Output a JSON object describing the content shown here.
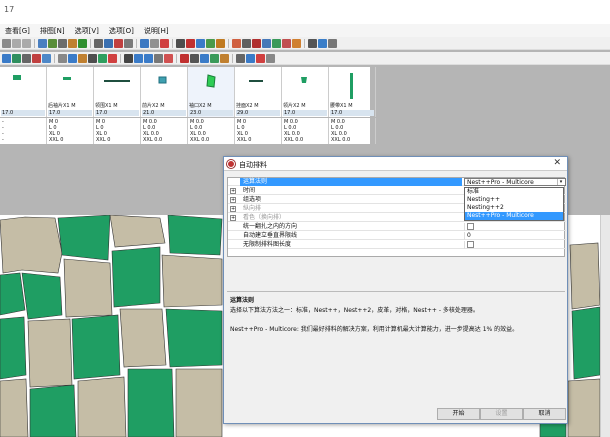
{
  "window": {
    "title": "17"
  },
  "menu": [
    "查看[G]",
    "排图[N]",
    "选项[V]",
    "选项[O]",
    "说明[H]"
  ],
  "colors": {
    "green": "#1f9e63",
    "tan": "#c5bda6",
    "selection": "#3399ff"
  },
  "pieces": [
    {
      "label": "",
      "size": "17.0"
    },
    {
      "label": "后袖片X1 M",
      "size": "17.0"
    },
    {
      "label": "领围X1 M",
      "size": "17.0"
    },
    {
      "label": "前片X2 M",
      "size": "21.0"
    },
    {
      "label": "袖口X2 M",
      "size": "23.0"
    },
    {
      "label": "挂面X2 M",
      "size": "29.0"
    },
    {
      "label": "领片X2 M",
      "size": "17.0"
    },
    {
      "label": "腰带X1 M",
      "size": "17.0"
    }
  ],
  "size_rows": [
    [
      "-",
      "-",
      "-",
      "-"
    ],
    [
      "M 0",
      "L 0",
      "XL 0",
      "XXL 0"
    ],
    [
      "M 0",
      "L 0",
      "XL 0",
      "XXL 0"
    ],
    [
      "M 0.0",
      "L 0.0",
      "XL 0.0",
      "XXL 0.0"
    ],
    [
      "M 0.0",
      "L 0.0",
      "XL 0.0",
      "XXL 0.0"
    ],
    [
      "M 0",
      "L 0",
      "XL 0",
      "XXL 0"
    ],
    [
      "M 0.0",
      "L 0.0",
      "XL 0.0",
      "XXL 0.0"
    ],
    [
      "M 0.0",
      "L 0.0",
      "XL 0.0",
      "XXL 0.0"
    ]
  ],
  "dialog": {
    "title": "自动排料",
    "close": "✕",
    "properties": {
      "algorithm": {
        "name": "运算法则",
        "value": "Nest++Pro - Multicore"
      },
      "time": {
        "name": "时间"
      },
      "group": {
        "name": "组选项"
      },
      "vertical": {
        "name": "纵向排"
      },
      "look": {
        "name": "看色（换向排）"
      },
      "same_dir": {
        "name": "统一翻扎之内的方向"
      },
      "auto_vertical": {
        "name": "自动建立垂直界限线",
        "value": "0"
      },
      "unlimited": {
        "name": "无限制排料图长度"
      }
    },
    "dropdown_options": [
      "标准",
      "Nesting++",
      "Nesting++2",
      "Nest++Pro - Multicore"
    ],
    "desc_heading": "运算法则",
    "desc_line1": "选择以下算法方法之一：标准，Nest++，Nest++2，皮革，对格，Nest++ - 多核处理器。",
    "desc_line2": "Nest++Pro - Multicore: 我们最好排料的解决方案，利用计算机最大计算能力，进一步提高达 1% 的效益。",
    "buttons": {
      "start": "开始",
      "save": "设置",
      "cancel": "取消"
    }
  }
}
